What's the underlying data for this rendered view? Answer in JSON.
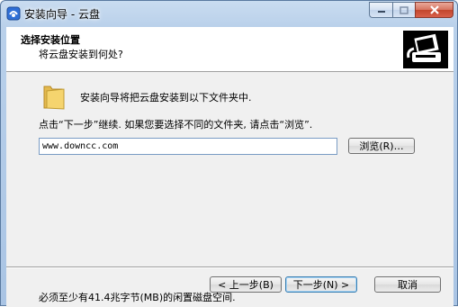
{
  "window": {
    "title": "安装向导 - 云盘"
  },
  "header": {
    "title": "选择安装位置",
    "subtitle": "将云盘安装到何处?"
  },
  "body": {
    "intro": "安装向导将把云盘安装到以下文件夹中.",
    "instruction": "点击“下一步”继续. 如果您要选择不同的文件夹, 请点击“浏览”.",
    "path_value": "www.downcc.com",
    "browse_label": "浏览(R)…",
    "space_required": "必须至少有41.4兆字节(MB)的闲置磁盘空间."
  },
  "buttons": {
    "back": "< 上一步(B)",
    "next": "下一步(N) >",
    "cancel": "取消"
  },
  "icons": {
    "app": "installer-app-icon",
    "folder": "folder-icon",
    "logo": "setup-logo-icon"
  },
  "colors": {
    "close_button": "#c2462c",
    "default_button_border": "#3c7fb1"
  }
}
